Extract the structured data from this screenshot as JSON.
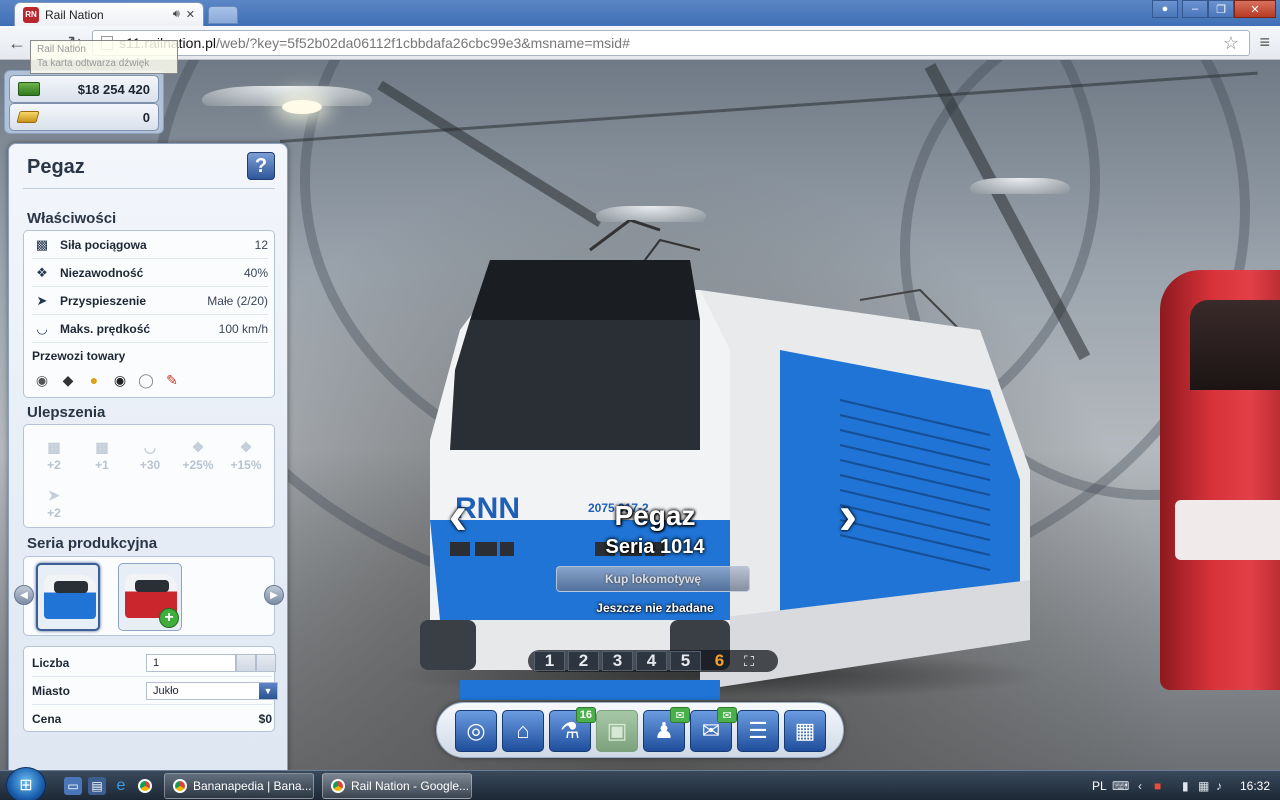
{
  "browser": {
    "tab_title": "Rail Nation",
    "tab_favicon_text": "RN",
    "url_host": "s11.railnation.pl",
    "url_path": "/web/?key=5f52b02da06112f1cbbdafa26cbc99e3&msname=msid#",
    "tooltip_line1": "Rail Nation",
    "tooltip_line2": "Ta karta odtwarza dźwięk"
  },
  "resources": {
    "money": "$18 254 420",
    "gold": "0"
  },
  "panel": {
    "title": "Pegaz",
    "help_label": "?",
    "properties_title": "Właściwości",
    "properties": [
      {
        "icon": "traction-icon",
        "label": "Siła pociągowa",
        "value": "12"
      },
      {
        "icon": "wrench-icon",
        "label": "Niezawodność",
        "value": "40%"
      },
      {
        "icon": "acceleration-icon",
        "label": "Przyspieszenie",
        "value": "Małe (2/20)"
      },
      {
        "icon": "speedometer-icon",
        "label": "Maks. prędkość",
        "value": "100 km/h"
      }
    ],
    "cargo_title": "Przewozi towary",
    "cargo": [
      "cattle-icon",
      "coal-icon",
      "grain-icon",
      "wood-icon",
      "pottery-icon",
      "paper-icon"
    ],
    "upgrades_title": "Ulepszenia",
    "upgrades": [
      {
        "icon": "traction-icon",
        "value": "+2"
      },
      {
        "icon": "traction-icon",
        "value": "+1"
      },
      {
        "icon": "speedometer-icon",
        "value": "+30"
      },
      {
        "icon": "wrench-icon",
        "value": "+25%"
      },
      {
        "icon": "wrench-icon",
        "value": "+15%"
      },
      {
        "icon": "acceleration-icon",
        "value": "+2"
      }
    ],
    "series_title": "Seria produkcyjna",
    "quantity_label": "Liczba",
    "quantity_value": "1",
    "city_label": "Miasto",
    "city_value": "Jukło",
    "price_label": "Cena",
    "price_value": "$0"
  },
  "locomotive": {
    "name": "Pegaz",
    "series": "Seria 1014",
    "buy_label": "Kup lokomotywę",
    "status": "Jeszcze nie zbadane",
    "brand_text": "RNN",
    "number_text": "2075 017-2"
  },
  "eras": [
    "1",
    "2",
    "3",
    "4",
    "5",
    "6"
  ],
  "current_era": "6",
  "bottom_menu": {
    "research_badge": "16"
  },
  "taskbar": {
    "task1": "Bananapedia | Bana...",
    "task2": "Rail Nation - Google...",
    "language": "PL",
    "clock": "16:32"
  },
  "colors": {
    "accent": "#2e569a",
    "era_current": "#f3a227",
    "badge": "#4bb04b",
    "loco_blue": "#1f74d6"
  }
}
